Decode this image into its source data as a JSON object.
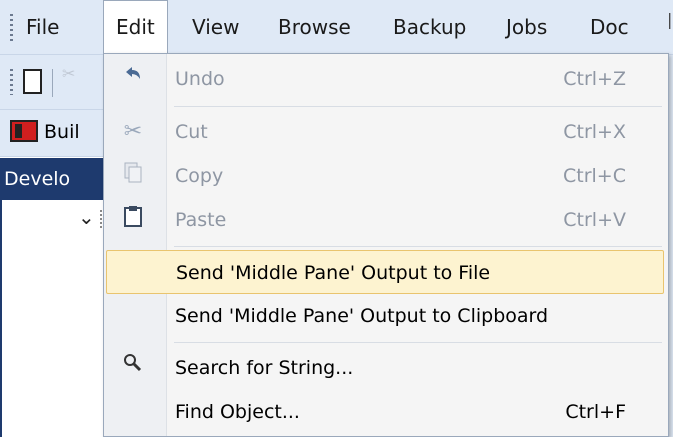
{
  "menubar": {
    "items": [
      {
        "label": "File"
      },
      {
        "label": "Edit"
      },
      {
        "label": "View"
      },
      {
        "label": "Browse"
      },
      {
        "label": "Backup"
      },
      {
        "label": "Jobs"
      },
      {
        "label": "Doc"
      }
    ]
  },
  "left_panel": {
    "tab_label": "Buil",
    "section_label": "Develo",
    "tree_chevron": "✓"
  },
  "edit_menu": {
    "items": [
      {
        "label": "Undo",
        "shortcut": "Ctrl+Z",
        "icon": "undo-icon",
        "enabled": false
      },
      {
        "label": "Cut",
        "shortcut": "Ctrl+X",
        "icon": "cut-icon",
        "enabled": false
      },
      {
        "label": "Copy",
        "shortcut": "Ctrl+C",
        "icon": "copy-icon",
        "enabled": false
      },
      {
        "label": "Paste",
        "shortcut": "Ctrl+V",
        "icon": "paste-icon",
        "enabled": false
      },
      {
        "label": "Send 'Middle Pane' Output to File",
        "shortcut": "",
        "enabled": true,
        "highlighted": true
      },
      {
        "label": "Send 'Middle Pane' Output to Clipboard",
        "shortcut": "",
        "enabled": true
      },
      {
        "label": "Search for String...",
        "shortcut": "",
        "icon": "search-icon",
        "enabled": true
      },
      {
        "label": "Find Object...",
        "shortcut": "Ctrl+F",
        "enabled": true
      }
    ]
  },
  "colors": {
    "menubar_bg": "#dfe9f6",
    "highlight_bg": "#fdf3d0",
    "highlight_border": "#e9c46e",
    "section_bar_bg": "#1e3a6e"
  }
}
